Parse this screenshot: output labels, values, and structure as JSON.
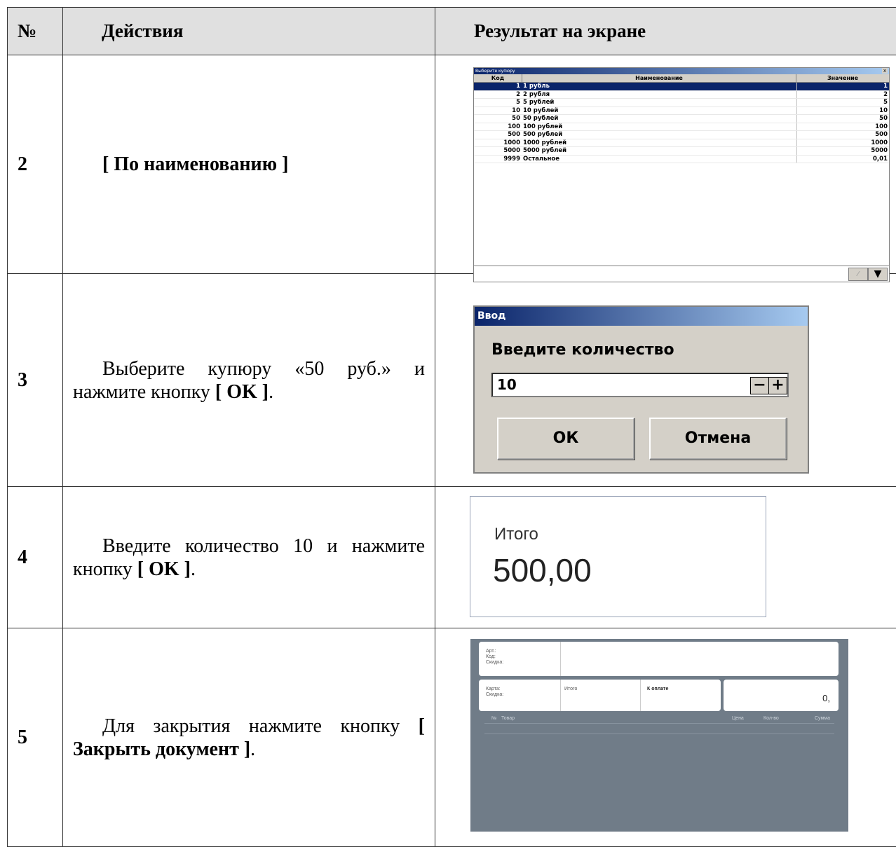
{
  "table": {
    "headers": [
      "№",
      "Действия",
      "Результат на экране"
    ],
    "rows": [
      {
        "num": "2",
        "action_bold": "[ По наименованию ]"
      },
      {
        "num": "3",
        "action_text": "Выберите купюру «50 руб.» и нажмите кнопку",
        "action_bold": "[ OK ]",
        "action_tail": "."
      },
      {
        "num": "4",
        "action_text": "Введите количество 10 и нажмите кнопку",
        "action_bold": "[ OK ]",
        "action_tail": "."
      },
      {
        "num": "5",
        "action_text": "Для закрытия нажмите кнопку",
        "action_bold": "[ Закрыть документ ]",
        "action_tail": "."
      }
    ]
  },
  "list_window": {
    "title": "Выберите купюру",
    "close": "x",
    "columns": [
      "Код",
      "Наименование",
      "Значение"
    ],
    "items": [
      {
        "code": "1",
        "name": "1 рубль",
        "value": "1"
      },
      {
        "code": "2",
        "name": "2 рубля",
        "value": "2"
      },
      {
        "code": "5",
        "name": "5 рублей",
        "value": "5"
      },
      {
        "code": "10",
        "name": "10 рублей",
        "value": "10"
      },
      {
        "code": "50",
        "name": "50 рублей",
        "value": "50"
      },
      {
        "code": "100",
        "name": "100 рублей",
        "value": "100"
      },
      {
        "code": "500",
        "name": "500 рублей",
        "value": "500"
      },
      {
        "code": "1000",
        "name": "1000 рублей",
        "value": "1000"
      },
      {
        "code": "5000",
        "name": "5000 рублей",
        "value": "5000"
      },
      {
        "code": "9999",
        "name": "Остальное",
        "value": "0,01"
      }
    ],
    "selected_index": 0
  },
  "input_dialog": {
    "title": "Ввод",
    "prompt": "Введите количество",
    "value": "10",
    "minus": "−",
    "plus": "+",
    "ok": "ОК",
    "cancel": "Отмена"
  },
  "total_panel": {
    "label": "Итого",
    "value": "500,00"
  },
  "pos_screen": {
    "art": "Арт.:",
    "code": "Код:",
    "discount": "Скидка:",
    "card": "Карта:",
    "discount2": "Скидка:",
    "itogo": "Итого",
    "to_pay": "К оплате",
    "amount": "0,",
    "col_no": "№",
    "col_item": "Товар",
    "col_price": "Цена",
    "col_qty": "Кол-во",
    "col_sum": "Сумма"
  }
}
